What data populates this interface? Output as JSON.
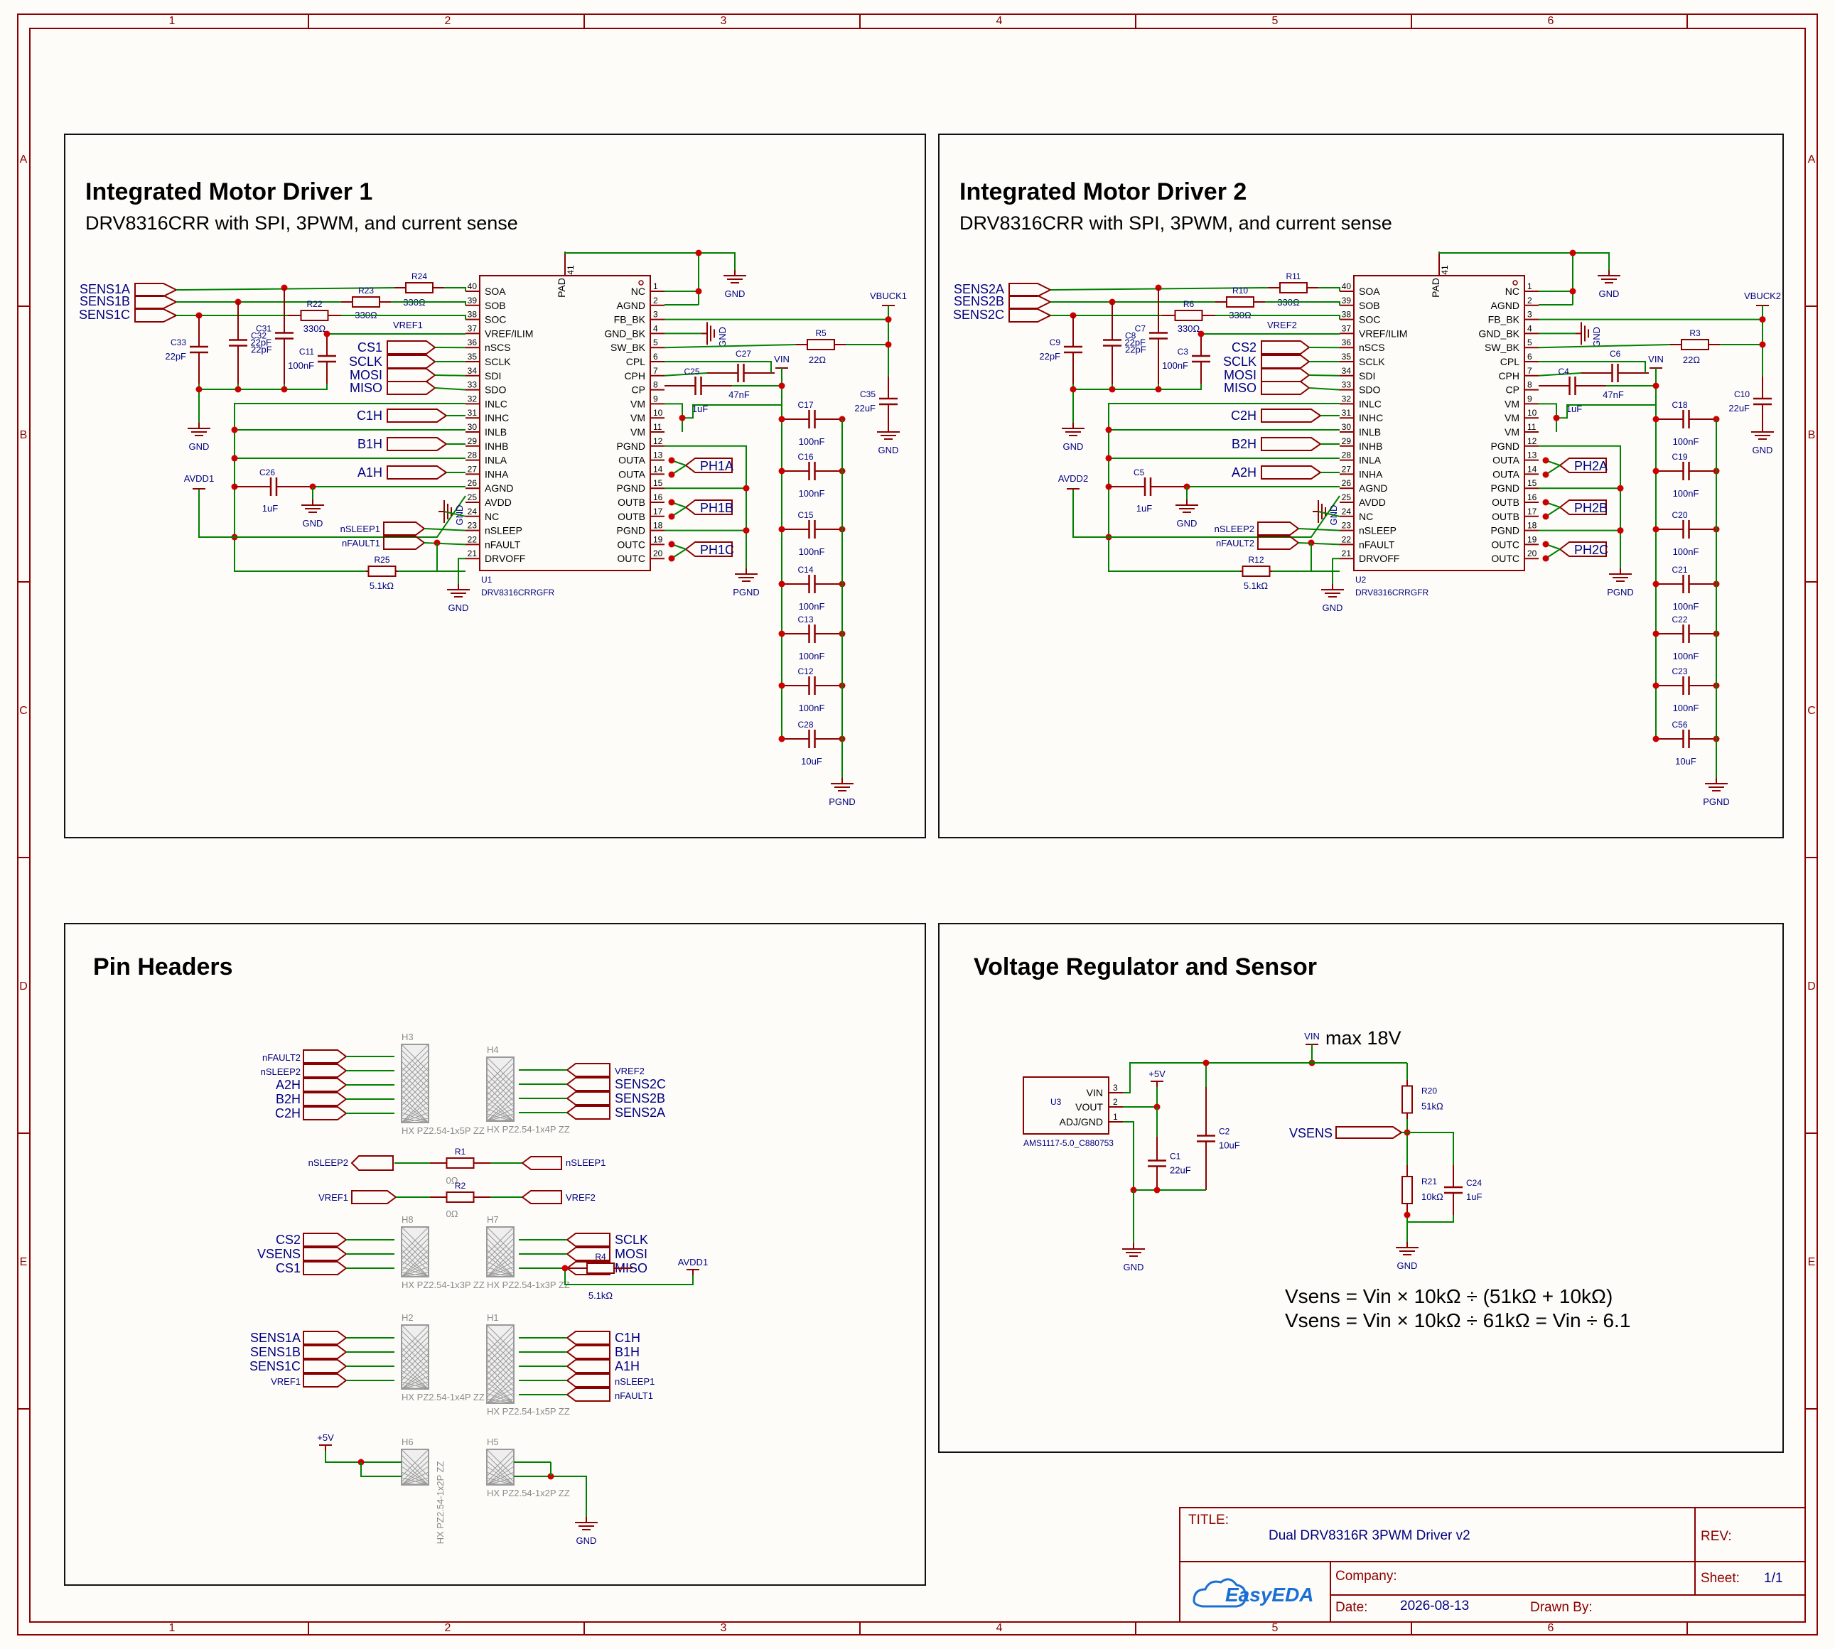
{
  "colors": {
    "wire": "#008000",
    "part": "#8b0000",
    "net": "#000080",
    "junction": "#cc0000",
    "frame": "#8b0000",
    "hatch": "#9a9a9a"
  },
  "frame": {
    "cols": [
      "1",
      "2",
      "3",
      "4",
      "5",
      "6"
    ],
    "rows": [
      "A",
      "B",
      "C",
      "D",
      "E"
    ]
  },
  "driver1": {
    "title": "Integrated Motor Driver 1",
    "subtitle": "DRV8316CRR with SPI, 3PWM, and current sense",
    "ref": "U1",
    "part": "DRV8316CRRGFR",
    "pad": "PAD",
    "pad_num": "41",
    "sense_nets": [
      "SENS1A",
      "SENS1B",
      "SENS1C"
    ],
    "spi_nets": [
      "CS1",
      "SCLK",
      "MOSI",
      "MISO"
    ],
    "pwm_nets": [
      "C1H",
      "B1H",
      "A1H"
    ],
    "phase_nets": [
      "PH1A",
      "PH1B",
      "PH1C"
    ],
    "vref": "VREF1",
    "avdd": "AVDD1",
    "nsleep": "nSLEEP1",
    "nfault": "nFAULT1",
    "vbuck": "VBUCK1",
    "vin": "VIN",
    "gnd": "GND",
    "pgnd": "PGND",
    "r24": [
      "R24",
      "330Ω"
    ],
    "r23": [
      "R23",
      "330Ω"
    ],
    "r22": [
      "R22",
      "330Ω"
    ],
    "r25": [
      "R25",
      "5.1kΩ"
    ],
    "r5": [
      "R5",
      "22Ω"
    ],
    "c33": [
      "C33",
      "22pF"
    ],
    "c32": [
      "C32",
      "22pF"
    ],
    "c31": [
      "C31",
      "22pF"
    ],
    "c11": [
      "C11",
      "100nF"
    ],
    "c26": [
      "C26",
      "1uF"
    ],
    "c25": [
      "C25",
      "1uF"
    ],
    "c27": [
      "C27",
      "47nF"
    ],
    "c35": [
      "C35",
      "22uF"
    ],
    "bank": [
      [
        "C17",
        "100nF"
      ],
      [
        "C16",
        "100nF"
      ],
      [
        "C15",
        "100nF"
      ],
      [
        "C14",
        "100nF"
      ],
      [
        "C13",
        "100nF"
      ],
      [
        "C12",
        "100nF"
      ],
      [
        "C28",
        "10uF"
      ]
    ]
  },
  "driver2": {
    "title": "Integrated Motor Driver 2",
    "subtitle": "DRV8316CRR with SPI, 3PWM, and current sense",
    "ref": "U2",
    "part": "DRV8316CRRGFR",
    "pad": "PAD",
    "pad_num": "41",
    "sense_nets": [
      "SENS2A",
      "SENS2B",
      "SENS2C"
    ],
    "spi_nets": [
      "CS2",
      "SCLK",
      "MOSI",
      "MISO"
    ],
    "pwm_nets": [
      "C2H",
      "B2H",
      "A2H"
    ],
    "phase_nets": [
      "PH2A",
      "PH2B",
      "PH2C"
    ],
    "vref": "VREF2",
    "avdd": "AVDD2",
    "nsleep": "nSLEEP2",
    "nfault": "nFAULT2",
    "vbuck": "VBUCK2",
    "vin": "VIN",
    "gnd": "GND",
    "pgnd": "PGND",
    "r24": [
      "R11",
      "330Ω"
    ],
    "r23": [
      "R10",
      "330Ω"
    ],
    "r22": [
      "R6",
      "330Ω"
    ],
    "r25": [
      "R12",
      "5.1kΩ"
    ],
    "r5": [
      "R3",
      "22Ω"
    ],
    "c33": [
      "C9",
      "22pF"
    ],
    "c32": [
      "C8",
      "22pF"
    ],
    "c31": [
      "C7",
      "22pF"
    ],
    "c11": [
      "C3",
      "100nF"
    ],
    "c26": [
      "C5",
      "1uF"
    ],
    "c25": [
      "C4",
      "1uF"
    ],
    "c27": [
      "C6",
      "47nF"
    ],
    "c35": [
      "C10",
      "22uF"
    ],
    "bank": [
      [
        "C18",
        "100nF"
      ],
      [
        "C19",
        "100nF"
      ],
      [
        "C20",
        "100nF"
      ],
      [
        "C21",
        "100nF"
      ],
      [
        "C22",
        "100nF"
      ],
      [
        "C23",
        "100nF"
      ],
      [
        "C56",
        "10uF"
      ]
    ]
  },
  "ic_pins": {
    "left": [
      [
        "40",
        "SOA"
      ],
      [
        "39",
        "SOB"
      ],
      [
        "38",
        "SOC"
      ],
      [
        "37",
        "VREF/ILIM"
      ],
      [
        "36",
        "nSCS"
      ],
      [
        "35",
        "SCLK"
      ],
      [
        "34",
        "SDI"
      ],
      [
        "33",
        "SDO"
      ],
      [
        "32",
        "INLC"
      ],
      [
        "31",
        "INHC"
      ],
      [
        "30",
        "INLB"
      ],
      [
        "29",
        "INHB"
      ],
      [
        "28",
        "INLA"
      ],
      [
        "27",
        "INHA"
      ],
      [
        "26",
        "AGND"
      ],
      [
        "25",
        "AVDD"
      ],
      [
        "24",
        "NC"
      ],
      [
        "23",
        "nSLEEP"
      ],
      [
        "22",
        "nFAULT"
      ],
      [
        "21",
        "DRVOFF"
      ]
    ],
    "right": [
      [
        "1",
        "NC"
      ],
      [
        "2",
        "AGND"
      ],
      [
        "3",
        "FB_BK"
      ],
      [
        "4",
        "GND_BK"
      ],
      [
        "5",
        "SW_BK"
      ],
      [
        "6",
        "CPL"
      ],
      [
        "7",
        "CPH"
      ],
      [
        "8",
        "CP"
      ],
      [
        "9",
        "VM"
      ],
      [
        "10",
        "VM"
      ],
      [
        "11",
        "VM"
      ],
      [
        "12",
        "PGND"
      ],
      [
        "13",
        "OUTA"
      ],
      [
        "14",
        "OUTA"
      ],
      [
        "15",
        "PGND"
      ],
      [
        "16",
        "OUTB"
      ],
      [
        "17",
        "OUTB"
      ],
      [
        "18",
        "PGND"
      ],
      [
        "19",
        "OUTC"
      ],
      [
        "20",
        "OUTC"
      ]
    ]
  },
  "headers": {
    "title": "Pin Headers",
    "h3": {
      "ref": "H3",
      "desc": "HX PZ2.54-1x5P ZZ",
      "nets": [
        "nFAULT2",
        "nSLEEP2",
        "A2H",
        "B2H",
        "C2H"
      ]
    },
    "h4": {
      "ref": "H4",
      "desc": "HX PZ2.54-1x4P ZZ",
      "nets": [
        "VREF2",
        "SENS2C",
        "SENS2B",
        "SENS2A"
      ]
    },
    "r1": {
      "ref": "R1",
      "val": "0Ω",
      "left": "nSLEEP2",
      "right": "nSLEEP1"
    },
    "r2": {
      "ref": "R2",
      "val": "0Ω",
      "left": "VREF1",
      "right": "VREF2"
    },
    "h8": {
      "ref": "H8",
      "desc": "HX PZ2.54-1x3P ZZ",
      "nets": [
        "CS2",
        "VSENS",
        "CS1"
      ]
    },
    "h7": {
      "ref": "H7",
      "desc": "HX PZ2.54-1x3P ZZ",
      "nets": [
        "SCLK",
        "MOSI",
        "MISO"
      ]
    },
    "r4": {
      "ref": "R4",
      "val": "5.1kΩ",
      "net": "AVDD1"
    },
    "h2": {
      "ref": "H2",
      "desc": "HX PZ2.54-1x4P ZZ",
      "nets": [
        "SENS1A",
        "SENS1B",
        "SENS1C",
        "VREF1"
      ]
    },
    "h1": {
      "ref": "H1",
      "desc": "HX PZ2.54-1x5P ZZ",
      "nets": [
        "C1H",
        "B1H",
        "A1H",
        "nSLEEP1",
        "nFAULT1"
      ]
    },
    "h6": {
      "ref": "H6",
      "desc": "HX PZ2.54-1x2P ZZ",
      "net": "+5V"
    },
    "h5": {
      "ref": "H5",
      "desc": "HX PZ2.54-1x2P ZZ",
      "net": "GND"
    }
  },
  "regulator": {
    "title": "Voltage Regulator and Sensor",
    "vin": "VIN",
    "vin_note": "max 18V",
    "ref": "U3",
    "part": "AMS1117-5.0_C880753",
    "pins": [
      "VIN",
      "VOUT",
      "ADJ/GND"
    ],
    "plus5": "+5V",
    "c1": [
      "C1",
      "22uF"
    ],
    "c2": [
      "C2",
      "10uF"
    ],
    "r20": [
      "R20",
      "51kΩ"
    ],
    "r21": [
      "R21",
      "10kΩ"
    ],
    "c24": [
      "C24",
      "1uF"
    ],
    "vsens": "VSENS",
    "gnd": "GND",
    "formula1": "Vsens = Vin × 10kΩ ÷ (51kΩ + 10kΩ)",
    "formula2": "Vsens = Vin × 10kΩ ÷ 61kΩ = Vin ÷ 6.1"
  },
  "titleblock": {
    "title_label": "TITLE:",
    "title": "Dual DRV8316R 3PWM Driver v2",
    "rev_label": "REV:",
    "company_label": "Company:",
    "sheet_label": "Sheet:",
    "sheet": "1/1",
    "date_label": "Date:",
    "date": "2026-08-13",
    "drawn_label": "Drawn By:",
    "logo": "EasyEDA"
  }
}
